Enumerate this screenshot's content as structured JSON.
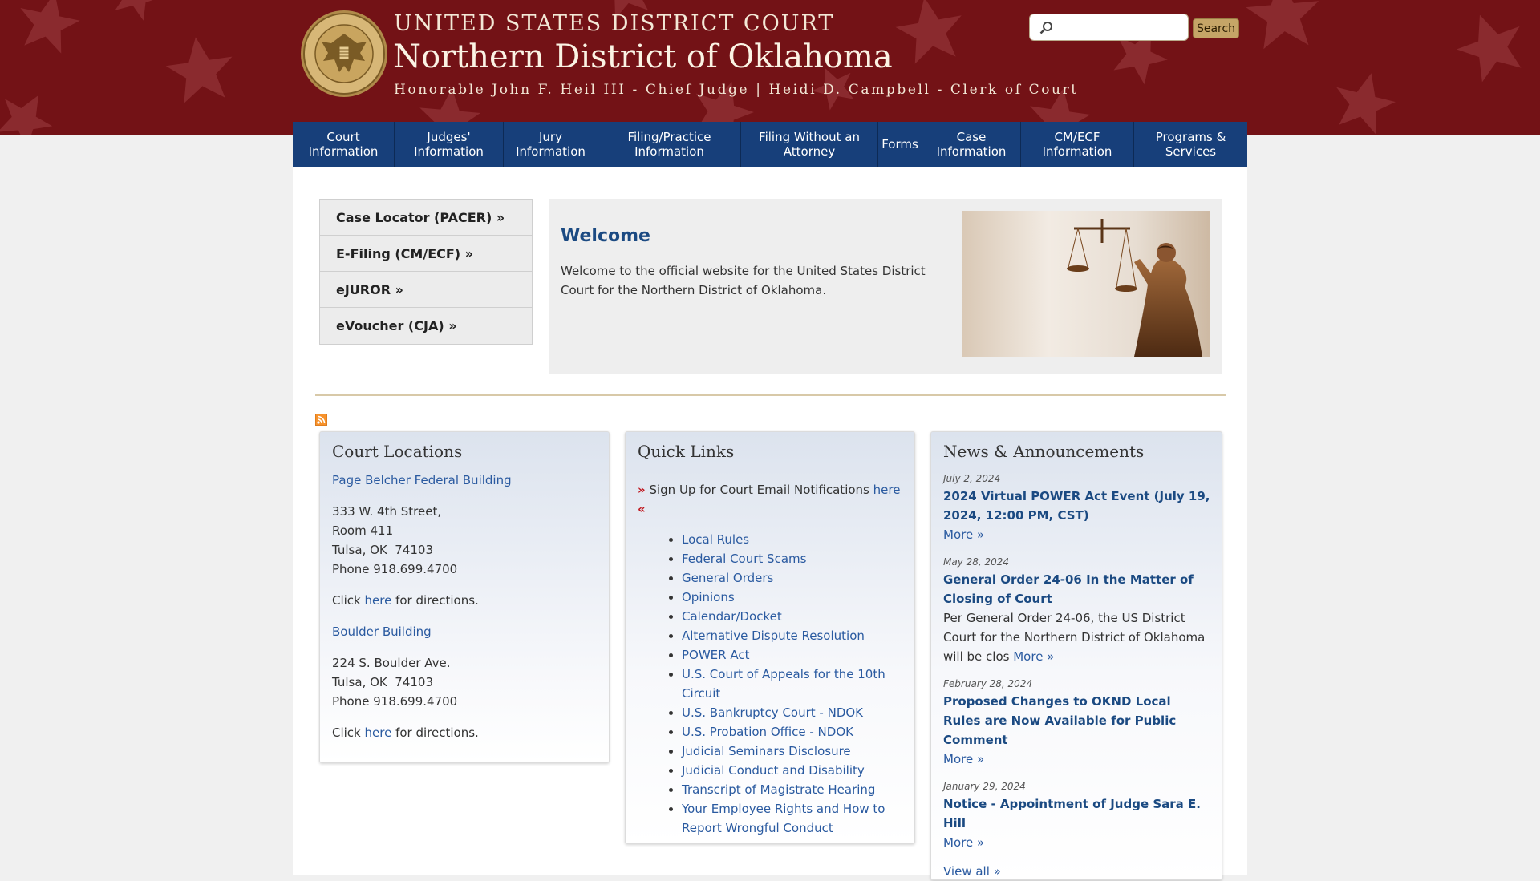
{
  "header": {
    "court_line": "UNITED STATES DISTRICT COURT",
    "district_line": "Northern District of Oklahoma",
    "officials_line": "Honorable John F. Heil III - Chief Judge | Heidi D. Campbell - Clerk of Court",
    "seal_alt": "Seal of the Northern District of Oklahoma",
    "search": {
      "value": "",
      "button_label": "Search"
    }
  },
  "colors": {
    "banner": "#731216",
    "nav": "#173f7a",
    "link": "#2a5aa0",
    "heading": "#1b4a82",
    "accent_red": "#c0151c",
    "search_button": "#c5a567"
  },
  "nav": {
    "items": [
      {
        "label": "Court\nInformation"
      },
      {
        "label": "Judges'\nInformation"
      },
      {
        "label": "Jury\nInformation"
      },
      {
        "label": "Filing/Practice\nInformation"
      },
      {
        "label": "Filing Without an\nAttorney"
      },
      {
        "label": "Forms"
      },
      {
        "label": "Case\nInformation"
      },
      {
        "label": "CM/ECF\nInformation"
      },
      {
        "label": "Programs &\nServices"
      }
    ]
  },
  "sidebar": {
    "links": [
      {
        "label": "Case Locator (PACER) »"
      },
      {
        "label": "E-Filing (CM/ECF) »"
      },
      {
        "label": "eJUROR »"
      },
      {
        "label": "eVoucher (CJA) »"
      }
    ]
  },
  "welcome": {
    "title": "Welcome",
    "text": "Welcome to the official website for the United States District Court for the Northern District of Oklahoma.",
    "image_icon": "lady-justice-statue-image"
  },
  "rss_icon": "rss-feed-icon",
  "locations": {
    "title": "Court Locations",
    "buildings": [
      {
        "name": "Page Belcher Federal Building",
        "address_lines": [
          "333 W. 4th Street,",
          "Room 411",
          "Tulsa, OK  74103",
          "Phone 918.699.4700"
        ],
        "directions_prefix": "Click ",
        "directions_link": "here",
        "directions_suffix": " for directions."
      },
      {
        "name": "Boulder Building",
        "address_lines": [
          "224 S. Boulder Ave.",
          "Tulsa, OK  74103",
          "Phone 918.699.4700"
        ],
        "directions_prefix": "Click ",
        "directions_link": "here",
        "directions_suffix": " for directions."
      }
    ]
  },
  "quicklinks": {
    "title": "Quick Links",
    "signup_open": "»",
    "signup_text": " Sign Up for Court Email Notifications ",
    "signup_link": "here",
    "signup_close": "«",
    "links": [
      "Local Rules",
      "Federal Court Scams",
      "General Orders",
      "Opinions",
      "Calendar/Docket",
      "Alternative Dispute Resolution",
      "POWER Act",
      "U.S. Court of Appeals for the 10th Circuit",
      "U.S. Bankruptcy Court - NDOK",
      "U.S. Probation Office - NDOK",
      "Judicial Seminars Disclosure",
      "Judicial Conduct and Disability",
      "Transcript of Magistrate Hearing",
      "Your Employee Rights and How to Report Wrongful Conduct"
    ]
  },
  "news": {
    "title": "News & Announcements",
    "items": [
      {
        "date": "July 2, 2024",
        "title": "2024 Virtual POWER Act Event (July 19, 2024, 12:00 PM, CST)",
        "summary": "",
        "more": "More »"
      },
      {
        "date": "May 28, 2024",
        "title": "General Order 24-06 In the Matter of Closing of Court",
        "summary": "Per General Order 24-06, the US District Court for the Northern District of Oklahoma will be clos ",
        "more": "More »"
      },
      {
        "date": "February 28, 2024",
        "title": "Proposed Changes to OKND Local Rules are Now Available for Public Comment",
        "summary": "",
        "more": "More »"
      },
      {
        "date": "January 29, 2024",
        "title": "Notice - Appointment of Judge Sara E. Hill",
        "summary": "",
        "more": "More »"
      }
    ],
    "view_all": "View all »"
  }
}
